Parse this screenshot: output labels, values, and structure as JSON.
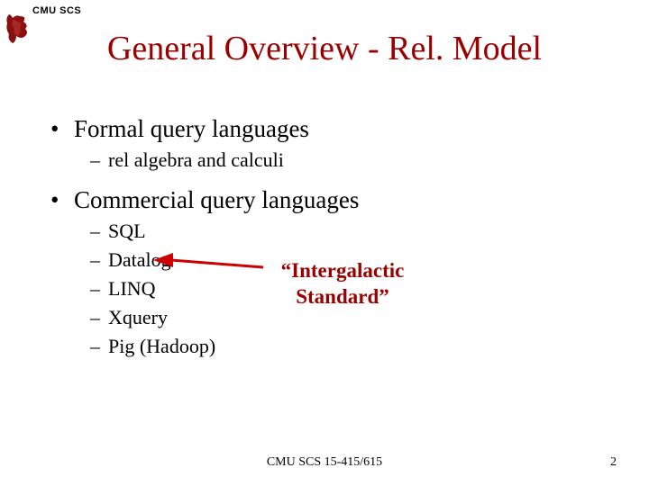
{
  "header": {
    "label": "CMU SCS"
  },
  "title": "General Overview - Rel. Model",
  "bullets": {
    "b1": {
      "text": "Formal query languages",
      "sub": {
        "s1": "rel algebra and calculi"
      }
    },
    "b2": {
      "text": "Commercial query languages",
      "sub": {
        "s1": "SQL",
        "s2": "Datalog",
        "s3": "LINQ",
        "s4": "Xquery",
        "s5": "Pig (Hadoop)"
      }
    }
  },
  "callout": {
    "line1": "“Intergalactic",
    "line2": "Standard”"
  },
  "footer": {
    "center": "CMU SCS 15-415/615",
    "page": "2"
  }
}
